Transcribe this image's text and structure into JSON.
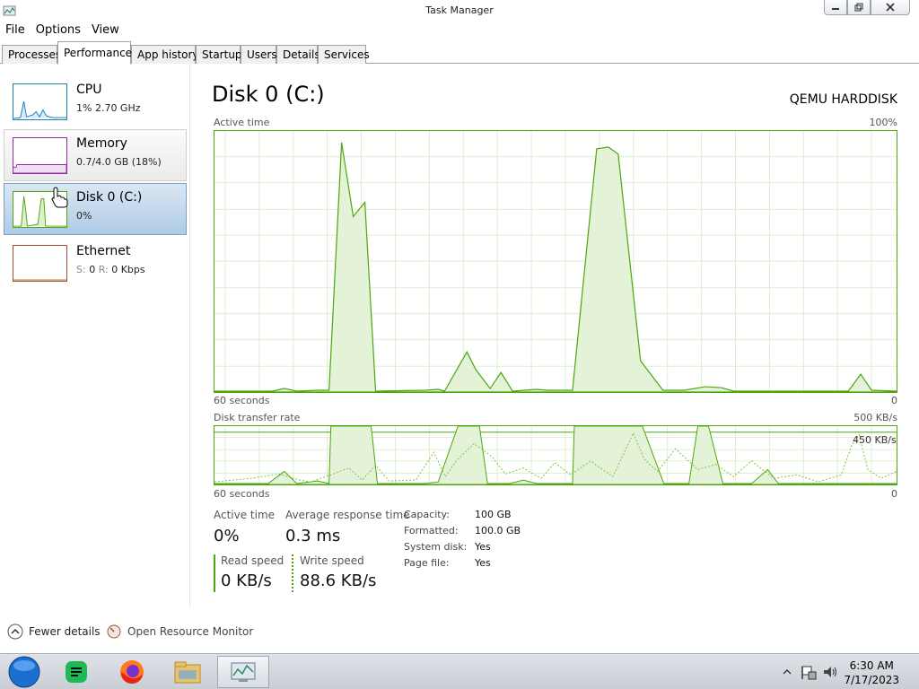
{
  "window": {
    "title": "Task Manager"
  },
  "menu": [
    "File",
    "Options",
    "View"
  ],
  "tabs": [
    "Processes",
    "Performance",
    "App history",
    "Startup",
    "Users",
    "Details",
    "Services"
  ],
  "sidebar": {
    "items": [
      {
        "title": "CPU",
        "sub": "1% 2.70 GHz"
      },
      {
        "title": "Memory",
        "sub": "0.7/4.0 GB (18%)"
      },
      {
        "title": "Disk 0 (C:)",
        "sub": "0%"
      },
      {
        "title": "Ethernet",
        "sub_s": "S:",
        "sub_s_val": "0",
        "sub_r": "R:",
        "sub_r_val": "0 Kbps"
      }
    ]
  },
  "disk": {
    "title": "Disk 0 (C:)",
    "model": "QEMU HARDDISK",
    "active_time_label": "Active time",
    "active_time_max": "100%",
    "graph1_left": "60 seconds",
    "graph1_right": "0",
    "transfer_label": "Disk transfer rate",
    "transfer_max": "500 KB/s",
    "transfer_mark": "450 KB/s",
    "graph2_left": "60 seconds",
    "graph2_right": "0",
    "stats": {
      "active_time": {
        "label": "Active time",
        "value": "0%"
      },
      "avg_response": {
        "label": "Average response time",
        "value": "0.3 ms"
      },
      "read_speed": {
        "label": "Read speed",
        "value": "0 KB/s"
      },
      "write_speed": {
        "label": "Write speed",
        "value": "88.6 KB/s"
      }
    },
    "info": [
      {
        "label": "Capacity:",
        "value": "100 GB"
      },
      {
        "label": "Formatted:",
        "value": "100.0 GB"
      },
      {
        "label": "System disk:",
        "value": "Yes"
      },
      {
        "label": "Page file:",
        "value": "Yes"
      }
    ]
  },
  "footer": {
    "fewer_details": "Fewer details",
    "resource_monitor": "Open Resource Monitor"
  },
  "taskbar": {
    "time": "6:30 AM",
    "date": "7/17/2023"
  },
  "colors": {
    "disk_green": "#4da60c",
    "cpu_blue": "#1a7fb5",
    "memory_purple": "#8b2f9e",
    "ethernet_orange": "#a0522d",
    "selected_bg": "#aecbe5"
  }
}
